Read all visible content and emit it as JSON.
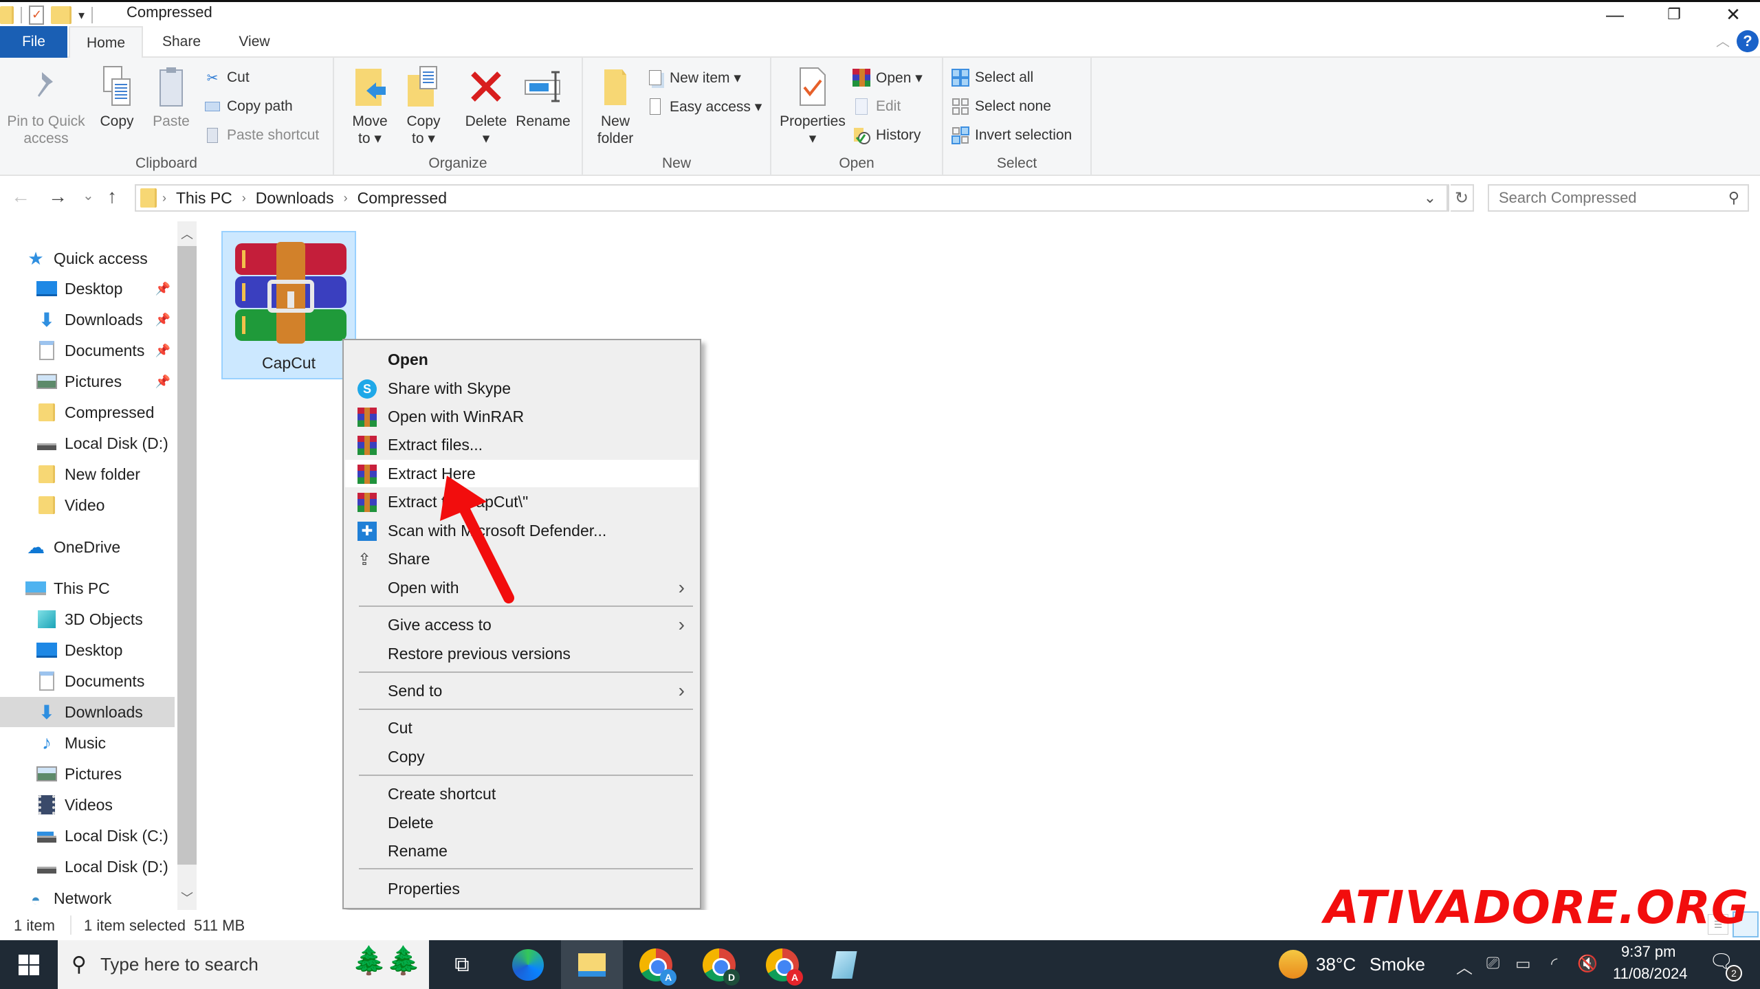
{
  "window": {
    "title": "Compressed",
    "controls": {
      "minimize": "—",
      "restore": "❐",
      "close": "✕"
    }
  },
  "ribbon": {
    "tabs": [
      {
        "label": "File"
      },
      {
        "label": "Home"
      },
      {
        "label": "Share"
      },
      {
        "label": "View"
      }
    ],
    "active_tab": "Home",
    "help": "?",
    "groups": {
      "clipboard": {
        "label": "Clipboard",
        "pin": "Pin to Quick\naccess",
        "pin_l1": "Pin to Quick",
        "pin_l2": "access",
        "copy": "Copy",
        "paste": "Paste",
        "cut": "Cut",
        "copy_path": "Copy path",
        "paste_shortcut": "Paste shortcut"
      },
      "organize": {
        "label": "Organize",
        "move_l1": "Move",
        "move_l2": "to ▾",
        "copy_l1": "Copy",
        "copy_l2": "to ▾",
        "delete": "Delete",
        "delete_drop": "▾",
        "rename": "Rename"
      },
      "new": {
        "label": "New",
        "new_folder_l1": "New",
        "new_folder_l2": "folder",
        "new_item": "New item ▾",
        "easy_access": "Easy access ▾"
      },
      "open": {
        "label": "Open",
        "properties": "Properties",
        "properties_drop": "▾",
        "open": "Open ▾",
        "edit": "Edit",
        "history": "History"
      },
      "select": {
        "label": "Select",
        "select_all": "Select all",
        "select_none": "Select none",
        "invert": "Invert selection"
      }
    }
  },
  "nav": {
    "back": "←",
    "forward": "→",
    "recent": "⌄",
    "up": "↑",
    "breadcrumb": [
      "This PC",
      "Downloads",
      "Compressed"
    ],
    "breadcrumb_sep": "›",
    "dropdown": "⌄",
    "refresh": "↻",
    "search_placeholder": "Search Compressed"
  },
  "sidebar": {
    "quick_access": {
      "label": "Quick access",
      "items": [
        {
          "label": "Desktop",
          "icon": "desktop-icon",
          "pinned": true
        },
        {
          "label": "Downloads",
          "icon": "downloads-icon",
          "pinned": true
        },
        {
          "label": "Documents",
          "icon": "documents-icon",
          "pinned": true
        },
        {
          "label": "Pictures",
          "icon": "pictures-icon",
          "pinned": true
        },
        {
          "label": "Compressed",
          "icon": "folder-icon",
          "pinned": false
        },
        {
          "label": "Local Disk (D:)",
          "icon": "drive-icon",
          "pinned": false
        },
        {
          "label": "New folder",
          "icon": "folder-icon",
          "pinned": false
        },
        {
          "label": "Video",
          "icon": "folder-icon",
          "pinned": false
        }
      ]
    },
    "onedrive": {
      "label": "OneDrive"
    },
    "this_pc": {
      "label": "This PC",
      "items": [
        {
          "label": "3D Objects",
          "icon": "3d-objects-icon"
        },
        {
          "label": "Desktop",
          "icon": "desktop-icon"
        },
        {
          "label": "Documents",
          "icon": "documents-icon"
        },
        {
          "label": "Downloads",
          "icon": "downloads-icon",
          "selected": true
        },
        {
          "label": "Music",
          "icon": "music-icon"
        },
        {
          "label": "Pictures",
          "icon": "pictures-icon"
        },
        {
          "label": "Videos",
          "icon": "videos-icon"
        },
        {
          "label": "Local Disk (C:)",
          "icon": "system-drive-icon"
        },
        {
          "label": "Local Disk (D:)",
          "icon": "drive-icon"
        }
      ]
    },
    "network": {
      "label": "Network"
    }
  },
  "content": {
    "files": [
      {
        "name": "CapCut",
        "type": "winrar-archive",
        "selected": true
      }
    ]
  },
  "context_menu": {
    "items": [
      {
        "label": "Open",
        "bold": true
      },
      {
        "label": "Share with Skype",
        "icon": "skype-icon"
      },
      {
        "label": "Open with WinRAR",
        "icon": "winrar-icon"
      },
      {
        "label": "Extract files...",
        "icon": "winrar-icon"
      },
      {
        "label": "Extract Here",
        "icon": "winrar-icon",
        "highlighted": true
      },
      {
        "label": "Extract to \"CapCut\\\"",
        "icon": "winrar-icon"
      },
      {
        "label": "Scan with Microsoft Defender...",
        "icon": "defender-icon"
      },
      {
        "label": "Share",
        "icon": "share-icon"
      },
      {
        "label": "Open with",
        "submenu": true
      },
      {
        "label": "Give access to",
        "submenu": true
      },
      {
        "label": "Restore previous versions"
      },
      {
        "label": "Send to",
        "submenu": true
      },
      {
        "label": "Cut"
      },
      {
        "label": "Copy"
      },
      {
        "label": "Create shortcut"
      },
      {
        "label": "Delete"
      },
      {
        "label": "Rename"
      },
      {
        "label": "Properties"
      }
    ],
    "submenu_arrow": "›"
  },
  "status": {
    "item_count": "1 item",
    "selection": "1 item selected",
    "size": "511 MB"
  },
  "watermark": "ATIVADORE.ORG",
  "taskbar": {
    "search_placeholder": "Type here to search",
    "apps": [
      "task-view",
      "edge",
      "file-explorer",
      "chrome-profile-a",
      "chrome-profile-d",
      "chrome-profile-adobe",
      "notepad"
    ],
    "chrome_badges": [
      "A",
      "D",
      "A"
    ],
    "weather": {
      "temp": "38°C",
      "condition": "Smoke"
    },
    "time": "9:37 pm",
    "date": "11/08/2024",
    "notifications": "2"
  },
  "colors": {
    "accent": "#1a5fb4",
    "selection_bg": "#cce8ff",
    "annotation_red": "#f20d0d",
    "taskbar_bg": "#1f2a35"
  }
}
